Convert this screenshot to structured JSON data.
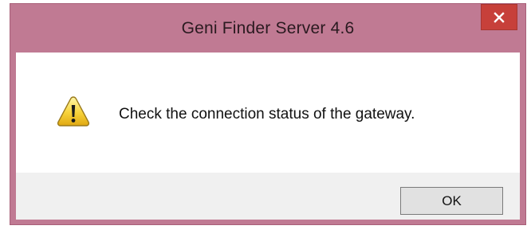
{
  "window": {
    "title": "Geni Finder Server 4.6",
    "close_icon": "close-icon",
    "frame_color": "#c07a93",
    "close_color": "#c7403a"
  },
  "message": {
    "icon": "warning-icon",
    "text": "Check the connection status of the gateway."
  },
  "buttons": {
    "ok_label": "OK"
  }
}
